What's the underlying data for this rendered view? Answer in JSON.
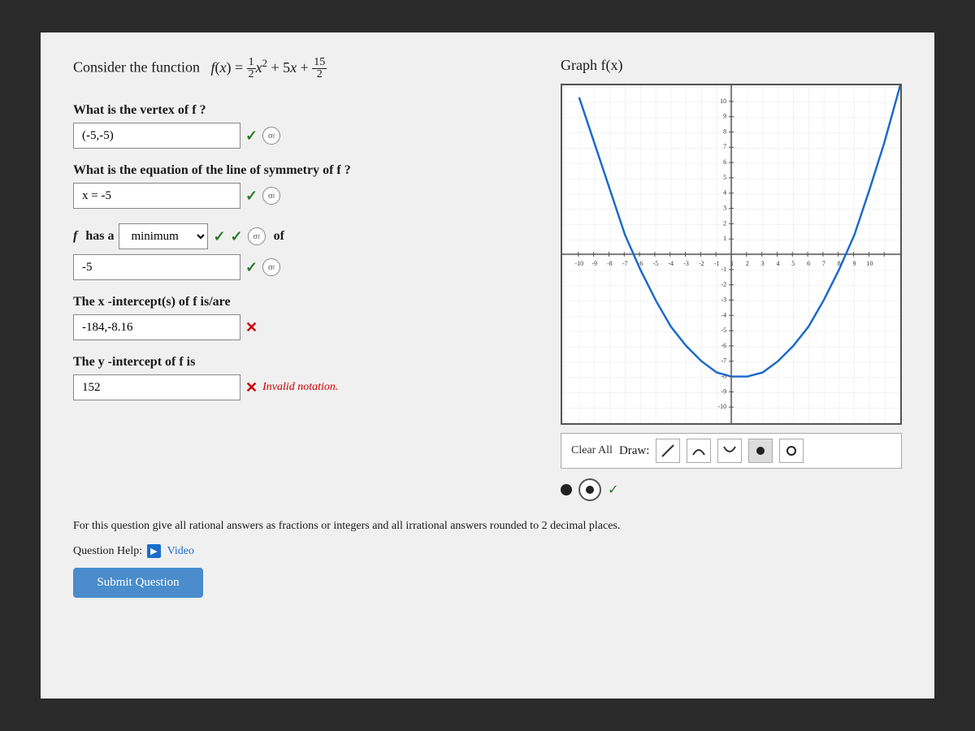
{
  "page": {
    "function_description": "Consider the function",
    "function_formula": "f(x) = ½x² + 5x + 15/2",
    "graph_title": "Graph f(x)",
    "questions": [
      {
        "id": "vertex",
        "label": "What is the vertex of f ?",
        "answer": "(-5,-5)",
        "status": "correct"
      },
      {
        "id": "symmetry",
        "label": "What is the equation of the line of symmetry of f ?",
        "answer": "x = -5",
        "status": "correct"
      },
      {
        "id": "minmax",
        "label": "f has a",
        "select_value": "minimum",
        "select_suffix": "of",
        "status": "correct"
      },
      {
        "id": "minmax_value",
        "answer": "-5",
        "status": "correct"
      },
      {
        "id": "x_intercept",
        "label": "The x -intercept(s) of f is/are",
        "answer": "-184,-8.16",
        "status": "wrong"
      },
      {
        "id": "y_intercept",
        "label": "The y -intercept of f is",
        "answer": "152",
        "status": "wrong",
        "error_message": "Invalid notation."
      }
    ],
    "draw_toolbar": {
      "clear_all_label": "Clear All",
      "draw_label": "Draw:",
      "tools": [
        "line",
        "curve_up",
        "curve_down",
        "dot",
        "circle"
      ]
    },
    "instructions": "For this question give all rational answers as fractions or integers and all irrational answers rounded to 2 decimal places.",
    "question_help_label": "Question Help:",
    "video_label": "Video",
    "submit_button_label": "Submit Question"
  }
}
